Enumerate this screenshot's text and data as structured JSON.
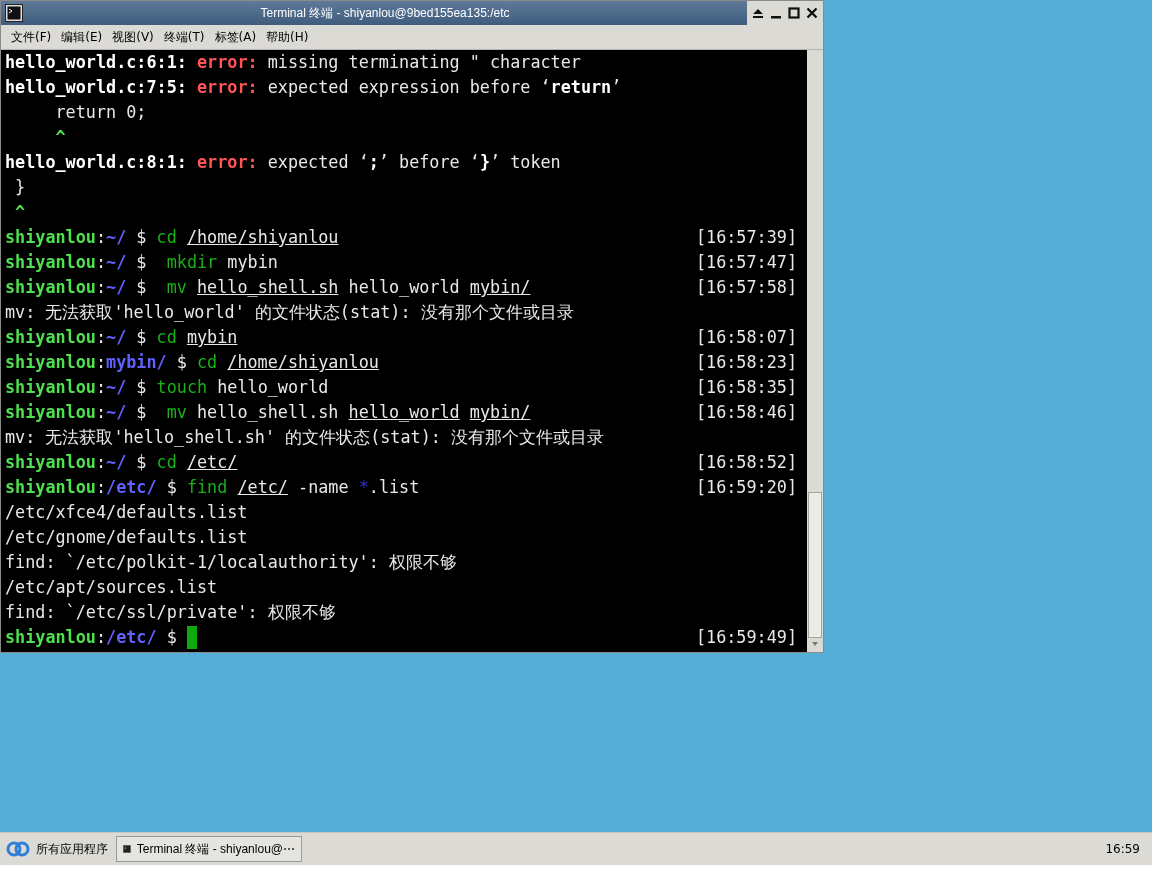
{
  "window": {
    "title": "Terminal 终端 - shiyanlou@9bed155ea135:/etc"
  },
  "menu": [
    "文件(F)",
    "编辑(E)",
    "视图(V)",
    "终端(T)",
    "标签(A)",
    "帮助(H)"
  ],
  "terminal": {
    "lines": [
      {
        "segments": [
          {
            "text": "hello_world.c:6:1: ",
            "kind": "bold"
          },
          {
            "text": "error:",
            "kind": "error"
          },
          {
            "text": " missing terminating \" character",
            "kind": "plain"
          }
        ]
      },
      {
        "segments": [
          {
            "text": "hello_world.c:7:5: ",
            "kind": "bold"
          },
          {
            "text": "error:",
            "kind": "error"
          },
          {
            "text": " expected expression before ‘",
            "kind": "plain"
          },
          {
            "text": "return",
            "kind": "bold"
          },
          {
            "text": "’",
            "kind": "plain"
          }
        ]
      },
      {
        "segments": [
          {
            "text": "     return 0;",
            "kind": "plain"
          }
        ]
      },
      {
        "segments": [
          {
            "text": "     ^",
            "kind": "caret"
          }
        ]
      },
      {
        "segments": [
          {
            "text": "hello_world.c:8:1: ",
            "kind": "bold"
          },
          {
            "text": "error:",
            "kind": "error"
          },
          {
            "text": " expected ‘",
            "kind": "plain"
          },
          {
            "text": ";",
            "kind": "bold"
          },
          {
            "text": "’ before ‘",
            "kind": "plain"
          },
          {
            "text": "}",
            "kind": "bold"
          },
          {
            "text": "’ token",
            "kind": "plain"
          }
        ]
      },
      {
        "segments": [
          {
            "text": " }",
            "kind": "plain"
          }
        ]
      },
      {
        "segments": [
          {
            "text": " ^",
            "kind": "caret"
          }
        ]
      },
      {
        "segments": [
          {
            "text": "shiyanlou",
            "kind": "user"
          },
          {
            "text": ":",
            "kind": "plain"
          },
          {
            "text": "~/",
            "kind": "path"
          },
          {
            "text": " $ ",
            "kind": "plain"
          },
          {
            "text": "cd",
            "kind": "cmd"
          },
          {
            "text": " /home/shiyanlou",
            "kind": "arg"
          }
        ],
        "time": "[16:57:39]"
      },
      {
        "segments": [
          {
            "text": "shiyanlou",
            "kind": "user"
          },
          {
            "text": ":",
            "kind": "plain"
          },
          {
            "text": "~/",
            "kind": "path"
          },
          {
            "text": " $  ",
            "kind": "plain"
          },
          {
            "text": "mkdir",
            "kind": "cmd"
          },
          {
            "text": " mybin",
            "kind": "plain"
          }
        ],
        "time": "[16:57:47]"
      },
      {
        "segments": [
          {
            "text": "shiyanlou",
            "kind": "user"
          },
          {
            "text": ":",
            "kind": "plain"
          },
          {
            "text": "~/",
            "kind": "path"
          },
          {
            "text": " $  ",
            "kind": "plain"
          },
          {
            "text": "mv",
            "kind": "cmd"
          },
          {
            "text": " hello_shell.sh",
            "kind": "arg"
          },
          {
            "text": " hello_world",
            "kind": "plain"
          },
          {
            "text": " mybin/",
            "kind": "arg"
          }
        ],
        "time": "[16:57:58]"
      },
      {
        "segments": [
          {
            "text": "mv: 无法获取'hello_world' 的文件状态(stat): 没有那个文件或目录",
            "kind": "plain"
          }
        ]
      },
      {
        "segments": [
          {
            "text": "shiyanlou",
            "kind": "user"
          },
          {
            "text": ":",
            "kind": "plain"
          },
          {
            "text": "~/",
            "kind": "path"
          },
          {
            "text": " $ ",
            "kind": "plain"
          },
          {
            "text": "cd",
            "kind": "cmd"
          },
          {
            "text": " mybin",
            "kind": "arg"
          }
        ],
        "time": "[16:58:07]"
      },
      {
        "segments": [
          {
            "text": "shiyanlou",
            "kind": "user"
          },
          {
            "text": ":",
            "kind": "plain"
          },
          {
            "text": "mybin/",
            "kind": "path"
          },
          {
            "text": " $ ",
            "kind": "plain"
          },
          {
            "text": "cd",
            "kind": "cmd"
          },
          {
            "text": " /home/shiyanlou",
            "kind": "arg"
          }
        ],
        "time": "[16:58:23]"
      },
      {
        "segments": [
          {
            "text": "shiyanlou",
            "kind": "user"
          },
          {
            "text": ":",
            "kind": "plain"
          },
          {
            "text": "~/",
            "kind": "path"
          },
          {
            "text": " $ ",
            "kind": "plain"
          },
          {
            "text": "touch",
            "kind": "cmd"
          },
          {
            "text": " hello_world",
            "kind": "plain"
          }
        ],
        "time": "[16:58:35]"
      },
      {
        "segments": [
          {
            "text": "shiyanlou",
            "kind": "user"
          },
          {
            "text": ":",
            "kind": "plain"
          },
          {
            "text": "~/",
            "kind": "path"
          },
          {
            "text": " $  ",
            "kind": "plain"
          },
          {
            "text": "mv",
            "kind": "cmd"
          },
          {
            "text": " hello_shell.sh",
            "kind": "plain"
          },
          {
            "text": " hello_world",
            "kind": "arg"
          },
          {
            "text": " mybin/",
            "kind": "arg"
          }
        ],
        "time": "[16:58:46]"
      },
      {
        "segments": [
          {
            "text": "mv: 无法获取'hello_shell.sh' 的文件状态(stat): 没有那个文件或目录",
            "kind": "plain"
          }
        ]
      },
      {
        "segments": [
          {
            "text": "shiyanlou",
            "kind": "user"
          },
          {
            "text": ":",
            "kind": "plain"
          },
          {
            "text": "~/",
            "kind": "path"
          },
          {
            "text": " $ ",
            "kind": "plain"
          },
          {
            "text": "cd",
            "kind": "cmd"
          },
          {
            "text": " /etc/",
            "kind": "arg"
          }
        ],
        "time": "[16:58:52]"
      },
      {
        "segments": [
          {
            "text": "shiyanlou",
            "kind": "user"
          },
          {
            "text": ":",
            "kind": "plain"
          },
          {
            "text": "/etc/",
            "kind": "path"
          },
          {
            "text": " $ ",
            "kind": "plain"
          },
          {
            "text": "find",
            "kind": "cmd"
          },
          {
            "text": " /etc/",
            "kind": "arg"
          },
          {
            "text": " -name ",
            "kind": "plain"
          },
          {
            "text": "*",
            "kind": "glob"
          },
          {
            "text": ".list",
            "kind": "plain"
          }
        ],
        "time": "[16:59:20]"
      },
      {
        "segments": [
          {
            "text": "/etc/xfce4/defaults.list",
            "kind": "plain"
          }
        ]
      },
      {
        "segments": [
          {
            "text": "/etc/gnome/defaults.list",
            "kind": "plain"
          }
        ]
      },
      {
        "segments": [
          {
            "text": "find: `/etc/polkit-1/localauthority': 权限不够",
            "kind": "plain"
          }
        ]
      },
      {
        "segments": [
          {
            "text": "/etc/apt/sources.list",
            "kind": "plain"
          }
        ]
      },
      {
        "segments": [
          {
            "text": "find: `/etc/ssl/private': 权限不够",
            "kind": "plain"
          }
        ]
      },
      {
        "segments": [
          {
            "text": "shiyanlou",
            "kind": "user"
          },
          {
            "text": ":",
            "kind": "plain"
          },
          {
            "text": "/etc/",
            "kind": "path"
          },
          {
            "text": " $ ",
            "kind": "plain"
          }
        ],
        "time": "[16:59:49]",
        "cursor": true
      }
    ]
  },
  "taskbar": {
    "start_label": "所有应用程序",
    "task_label": "Terminal 终端 - shiyanlou@⋯",
    "clock": "16:59"
  }
}
